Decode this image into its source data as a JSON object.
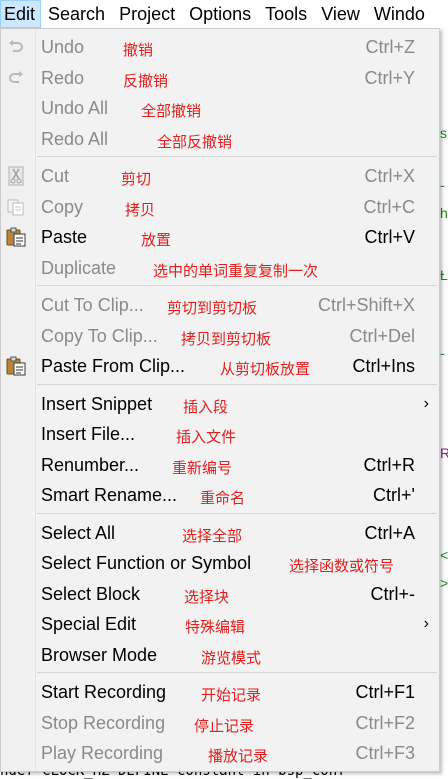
{
  "menubar": {
    "items": [
      "Edit",
      "Search",
      "Project",
      "Options",
      "Tools",
      "View",
      "Windo"
    ]
  },
  "menu": {
    "groups": [
      [
        {
          "label": "Undo",
          "note": "撤销",
          "shortcut": "Ctrl+Z",
          "enabled": false,
          "icon": "undo-icon"
        },
        {
          "label": "Redo",
          "note": "反撤销",
          "shortcut": "Ctrl+Y",
          "enabled": false,
          "icon": "redo-icon"
        },
        {
          "label": "Undo All",
          "note": "全部撤销",
          "shortcut": "",
          "enabled": false,
          "icon": ""
        },
        {
          "label": "Redo All",
          "note": "全部反撤销",
          "shortcut": "",
          "enabled": false,
          "icon": ""
        }
      ],
      [
        {
          "label": "Cut",
          "note": "剪切",
          "shortcut": "Ctrl+X",
          "enabled": false,
          "icon": "scissors-icon"
        },
        {
          "label": "Copy",
          "note": "拷贝",
          "shortcut": "Ctrl+C",
          "enabled": false,
          "icon": "copy-icon"
        },
        {
          "label": "Paste",
          "note": "放置",
          "shortcut": "Ctrl+V",
          "enabled": true,
          "icon": "clipboard-icon"
        },
        {
          "label": "Duplicate",
          "note": "选中的单词重复复制一次",
          "shortcut": "",
          "enabled": false,
          "icon": ""
        }
      ],
      [
        {
          "label": "Cut To Clip...",
          "note": "剪切到剪切板",
          "shortcut": "Ctrl+Shift+X",
          "enabled": false,
          "icon": ""
        },
        {
          "label": "Copy To Clip...",
          "note": "拷贝到剪切板",
          "shortcut": "Ctrl+Del",
          "enabled": false,
          "icon": ""
        },
        {
          "label": "Paste From Clip...",
          "note": "从剪切板放置",
          "shortcut": "Ctrl+Ins",
          "enabled": true,
          "icon": "clipboard-icon"
        }
      ],
      [
        {
          "label": "Insert Snippet",
          "note": "插入段",
          "shortcut": "",
          "enabled": true,
          "icon": "",
          "submenu": true
        },
        {
          "label": "Insert File...",
          "note": "插入文件",
          "shortcut": "",
          "enabled": true,
          "icon": ""
        },
        {
          "label": "Renumber...",
          "note": "重新编号",
          "shortcut": "Ctrl+R",
          "enabled": true,
          "icon": ""
        },
        {
          "label": "Smart Rename...",
          "note": "重命名",
          "shortcut": "Ctrl+'",
          "enabled": true,
          "icon": ""
        }
      ],
      [
        {
          "label": "Select All",
          "note": "选择全部",
          "shortcut": "Ctrl+A",
          "enabled": true,
          "icon": ""
        },
        {
          "label": "Select Function or Symbol",
          "note": "选择函数或符号",
          "shortcut": "",
          "enabled": true,
          "icon": ""
        },
        {
          "label": "Select Block",
          "note": "选择块",
          "shortcut": "Ctrl+-",
          "enabled": true,
          "icon": ""
        },
        {
          "label": "Special Edit",
          "note": "特殊编辑",
          "shortcut": "",
          "enabled": true,
          "icon": "",
          "submenu": true
        },
        {
          "label": "Browser Mode",
          "note": "游览模式",
          "shortcut": "",
          "enabled": true,
          "icon": ""
        }
      ],
      [
        {
          "label": "Start Recording",
          "note": "开始记录",
          "shortcut": "Ctrl+F1",
          "enabled": true,
          "icon": ""
        },
        {
          "label": "Stop Recording",
          "note": "停止记录",
          "shortcut": "Ctrl+F2",
          "enabled": false,
          "icon": ""
        },
        {
          "label": "Play Recording",
          "note": "播放记录",
          "shortcut": "Ctrl+F3",
          "enabled": false,
          "icon": ""
        }
      ]
    ]
  },
  "background": {
    "bottom_text": "ndef  CLOCK_HZ  DEFINE   constant in bsp_conf",
    "strip_marks": [
      {
        "ch": "s",
        "color": "#1a8a1a"
      },
      {
        "ch": "-",
        "color": "#1a8a1a"
      },
      {
        "ch": "h",
        "color": "#1a8a1a"
      },
      {
        "ch": "-",
        "color": "#1a8a1a"
      },
      {
        "ch": "L",
        "color": "#1a8a1a"
      },
      {
        "ch": "-",
        "color": "#1a8a1a"
      },
      {
        "ch": "R",
        "color": "#8a1a8a"
      },
      {
        "ch": "<",
        "color": "#1a8a1a"
      },
      {
        "ch": ">",
        "color": "#1a8a1a"
      }
    ]
  },
  "colors": {
    "note": "#e0201e",
    "disabled": "#8a8a8a",
    "menu_bg": "#f2f2f2",
    "active_menubar": "#cce8ff"
  }
}
